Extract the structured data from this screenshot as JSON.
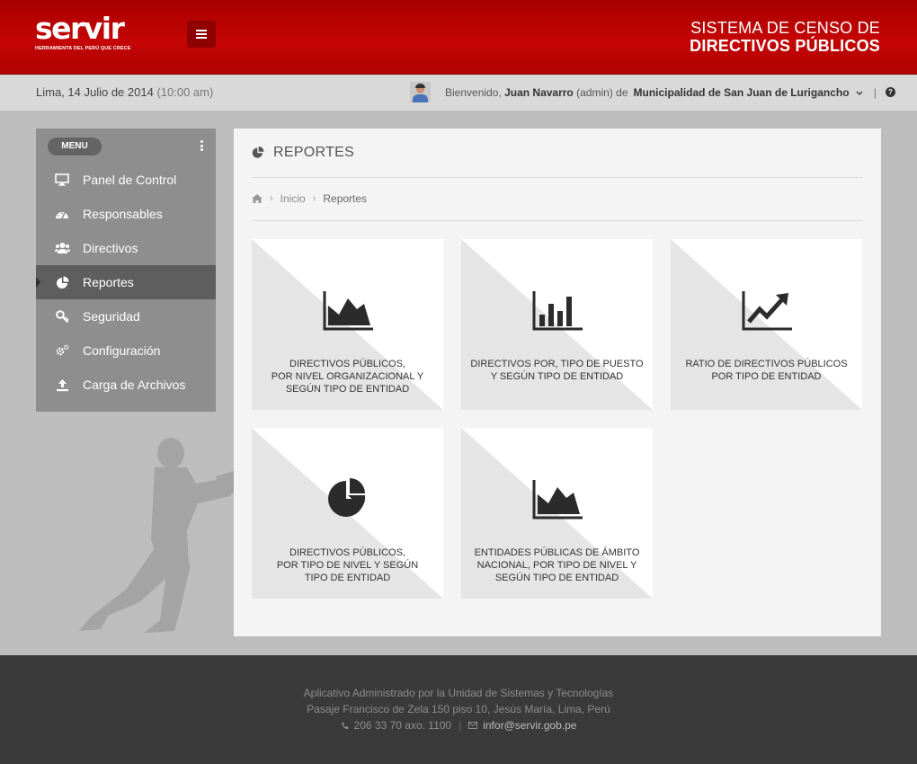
{
  "header": {
    "logo_text": "servir",
    "logo_tagline": "HERRAMIENTA DEL PERÚ QUE CRECE",
    "system_title_line1": "SISTEMA DE CENSO  DE",
    "system_title_line2": "DIRECTIVOS PÚBLICOS",
    "accent_color": "#b00000"
  },
  "infobar": {
    "date": "Lima, 14 Julio de 2014",
    "time": "(10:00 am)",
    "welcome": "Bienvenido,",
    "user_name": "Juan Navarro",
    "user_role": "(admin)",
    "of_label": "de",
    "organization": "Municipalidad de San Juan de Lurigancho",
    "separator": "|"
  },
  "sidebar": {
    "menu_label": "MENU",
    "items": [
      {
        "label": "Panel de Control",
        "icon": "monitor-icon"
      },
      {
        "label": "Responsables",
        "icon": "dashboard-icon"
      },
      {
        "label": "Directivos",
        "icon": "users-icon"
      },
      {
        "label": "Reportes",
        "icon": "pie-chart-icon",
        "active": true
      },
      {
        "label": "Seguridad",
        "icon": "key-icon"
      },
      {
        "label": "Configuración",
        "icon": "gears-icon"
      },
      {
        "label": "Carga de Archivos",
        "icon": "upload-icon"
      }
    ]
  },
  "main": {
    "title": "REPORTES",
    "breadcrumb": [
      "Inicio",
      "Reportes"
    ],
    "cards": [
      {
        "label": "DIRECTIVOS PÚBLICOS,\nPOR NIVEL ORGANIZACIONAL Y\nSEGÚN TIPO DE ENTIDAD",
        "icon": "area-chart-icon"
      },
      {
        "label": "DIRECTIVOS POR, TIPO DE PUESTO\nY SEGÚN TIPO DE ENTIDAD",
        "icon": "bar-chart-icon"
      },
      {
        "label": "RATIO DE DIRECTIVOS PÚBLICOS\nPOR TIPO DE ENTIDAD",
        "icon": "line-chart-icon"
      },
      {
        "label": "DIRECTIVOS PÚBLICOS,\nPOR TIPO DE NIVEL Y SEGÚN\nTIPO DE ENTIDAD",
        "icon": "pie-chart-icon"
      },
      {
        "label": "ENTIDADES PÚBLICAS DE ÁMBITO\nNACIONAL, POR TIPO DE NIVEL Y\nSEGÚN TIPO DE ENTIDAD",
        "icon": "area-chart-icon"
      }
    ]
  },
  "footer": {
    "line1": "Aplicativo Administrado por la Unidad de Sistemas y Tecnologías",
    "line2": "Pasaje Francisco de Zela 150 piso 10, Jesús María, Lima, Perú",
    "phone": "206 33 70 axo. 1100",
    "separator": "|",
    "email": "infor@servir.gob.pe"
  }
}
